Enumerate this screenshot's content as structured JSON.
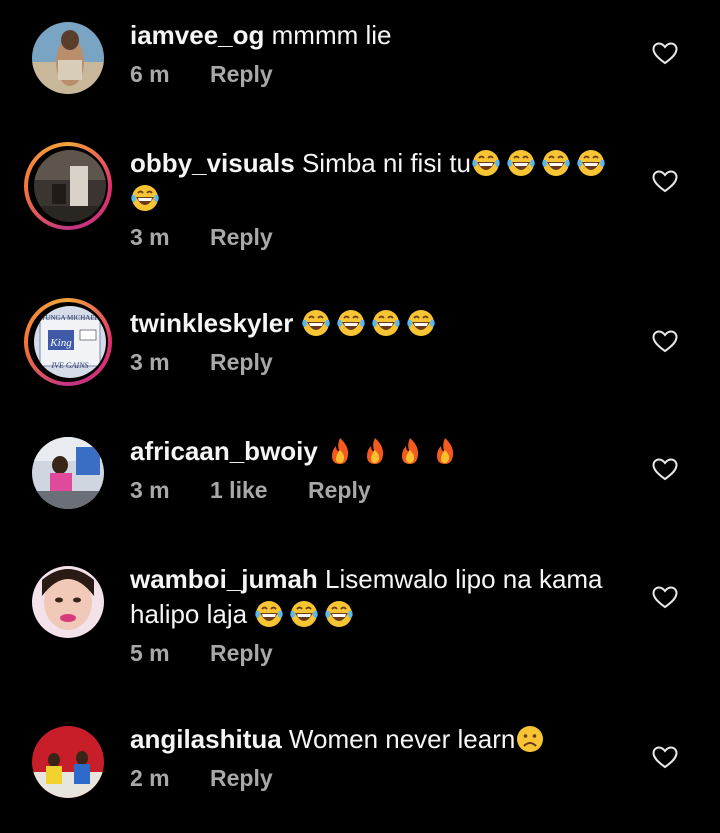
{
  "comments": [
    {
      "username": "iamvee_og",
      "text": " mmmm lie",
      "time": "6 m",
      "reply": "Reply",
      "emoji_icons": []
    },
    {
      "username": "obby_visuals",
      "text": " Simba ni fisi tu",
      "time": "3 m",
      "reply": "Reply",
      "emoji_icons": [
        "grinning-tears-emoji",
        "grinning-tears-emoji",
        "grinning-tears-emoji",
        "grinning-tears-emoji",
        "grinning-tears-emoji"
      ]
    },
    {
      "username": "twinkleskyler",
      "text": " ",
      "time": "3 m",
      "reply": "Reply",
      "emoji_icons": [
        "grinning-tears-emoji",
        "grinning-tears-emoji",
        "grinning-tears-emoji",
        "grinning-tears-emoji"
      ]
    },
    {
      "username": "africaan_bwoiy",
      "text": " ",
      "time": "3 m",
      "likes": "1 like",
      "reply": "Reply",
      "emoji_icons": [
        "fire-emoji",
        "fire-emoji",
        "fire-emoji",
        "fire-emoji"
      ]
    },
    {
      "username": "wamboi_jumah",
      "text": " Lisemwalo lipo na kama halipo laja ",
      "time": "5 m",
      "reply": "Reply",
      "emoji_icons": [
        "grinning-tears-emoji",
        "grinning-tears-emoji",
        "grinning-tears-emoji"
      ]
    },
    {
      "username": "angilashitua",
      "text": " Women never learn",
      "time": "2 m",
      "reply": "Reply",
      "emoji_icons": [
        "frowning-emoji"
      ]
    }
  ],
  "avatar_texts": {
    "twinkleskyler_top": "TUNGA MICHAEL",
    "twinkleskyler_mid": "King",
    "twinkleskyler_bottom": "IVE GAINS"
  },
  "icons": {
    "like": "heart-outline-icon"
  },
  "colors": {
    "background": "#000000",
    "text": "#f5f5f5",
    "meta": "#a8a8a8",
    "story_ring": "#e1306c"
  }
}
